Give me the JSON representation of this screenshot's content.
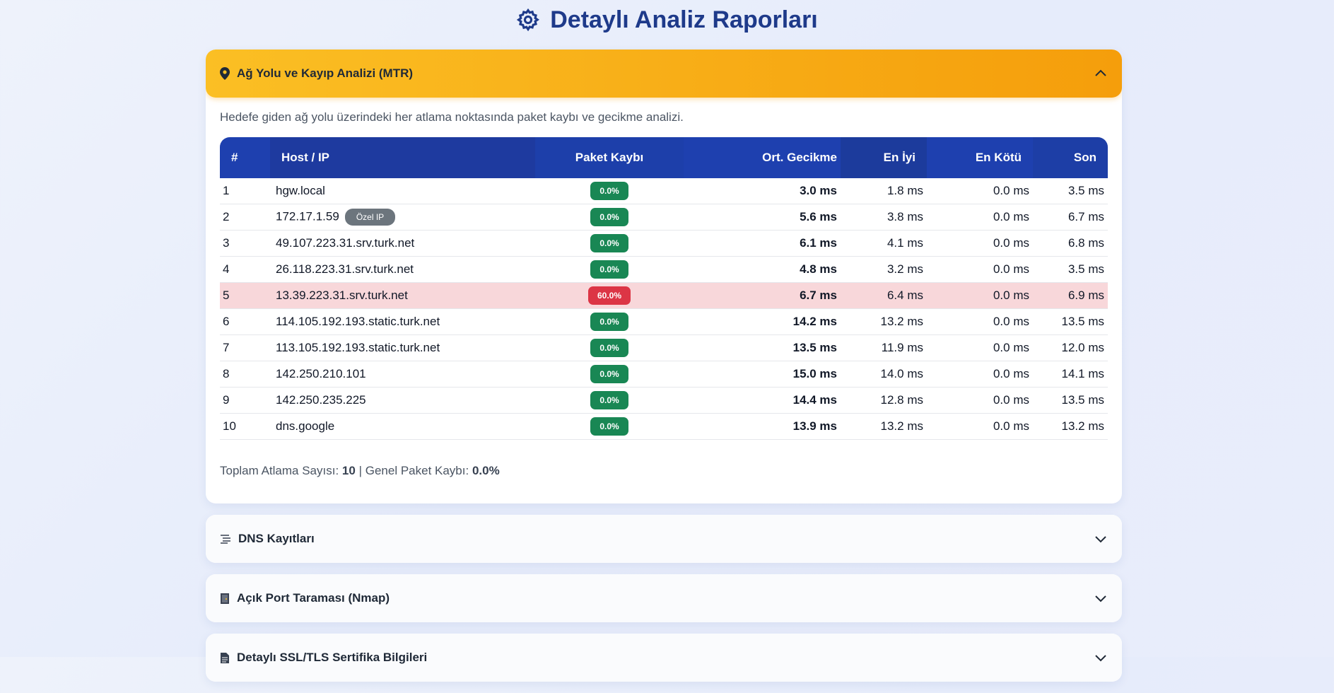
{
  "page": {
    "title": "Detaylı Analiz Raporları",
    "icon": "gear-icon",
    "accent": "#1e3a8a"
  },
  "mtr": {
    "title": "Ağ Yolu ve Kayıp Analizi (MTR)",
    "icon": "map-pin-icon",
    "description": "Hedefe giden ağ yolu üzerindeki her atlama noktasında paket kaybı ve gecikme analizi.",
    "columns": [
      "#",
      "Host / IP",
      "Paket Kaybı",
      "Ort. Gecikme",
      "En İyi",
      "En Kötü",
      "Son"
    ],
    "rows": [
      {
        "num": "1",
        "host": "hgw.local",
        "tag": "",
        "loss": "0.0%",
        "avg": "3.0 ms",
        "best": "1.8 ms",
        "worst": "0.0 ms",
        "last": "3.5 ms",
        "warn": false
      },
      {
        "num": "2",
        "host": "172.17.1.59",
        "tag": "Özel IP",
        "loss": "0.0%",
        "avg": "5.6 ms",
        "best": "3.8 ms",
        "worst": "0.0 ms",
        "last": "6.7 ms",
        "warn": false
      },
      {
        "num": "3",
        "host": "49.107.223.31.srv.turk.net",
        "tag": "",
        "loss": "0.0%",
        "avg": "6.1 ms",
        "best": "4.1 ms",
        "worst": "0.0 ms",
        "last": "6.8 ms",
        "warn": false
      },
      {
        "num": "4",
        "host": "26.118.223.31.srv.turk.net",
        "tag": "",
        "loss": "0.0%",
        "avg": "4.8 ms",
        "best": "3.2 ms",
        "worst": "0.0 ms",
        "last": "3.5 ms",
        "warn": false
      },
      {
        "num": "5",
        "host": "13.39.223.31.srv.turk.net",
        "tag": "",
        "loss": "60.0%",
        "avg": "6.7 ms",
        "best": "6.4 ms",
        "worst": "0.0 ms",
        "last": "6.9 ms",
        "warn": true
      },
      {
        "num": "6",
        "host": "114.105.192.193.static.turk.net",
        "tag": "",
        "loss": "0.0%",
        "avg": "14.2 ms",
        "best": "13.2 ms",
        "worst": "0.0 ms",
        "last": "13.5 ms",
        "warn": false
      },
      {
        "num": "7",
        "host": "113.105.192.193.static.turk.net",
        "tag": "",
        "loss": "0.0%",
        "avg": "13.5 ms",
        "best": "11.9 ms",
        "worst": "0.0 ms",
        "last": "12.0 ms",
        "warn": false
      },
      {
        "num": "8",
        "host": "142.250.210.101",
        "tag": "",
        "loss": "0.0%",
        "avg": "15.0 ms",
        "best": "14.0 ms",
        "worst": "0.0 ms",
        "last": "14.1 ms",
        "warn": false
      },
      {
        "num": "9",
        "host": "142.250.235.225",
        "tag": "",
        "loss": "0.0%",
        "avg": "14.4 ms",
        "best": "12.8 ms",
        "worst": "0.0 ms",
        "last": "13.5 ms",
        "warn": false
      },
      {
        "num": "10",
        "host": "dns.google",
        "tag": "",
        "loss": "0.0%",
        "avg": "13.9 ms",
        "best": "13.2 ms",
        "worst": "0.0 ms",
        "last": "13.2 ms",
        "warn": false
      }
    ],
    "summary": {
      "hops_label": "Toplam Atlama Sayısı:",
      "hops_value": "10",
      "separator": "|",
      "loss_label": "Genel Paket Kaybı:",
      "loss_value": "0.0%"
    }
  },
  "sections": [
    {
      "title": "DNS Kayıtları",
      "icon": "list-icon"
    },
    {
      "title": "Açık Port Taraması (Nmap)",
      "icon": "door-icon"
    },
    {
      "title": "Detaylı SSL/TLS Sertifika Bilgileri",
      "icon": "document-icon"
    }
  ],
  "colors": {
    "header_gold": "#fbbf24",
    "table_header": "#1e40af",
    "ok_badge": "#198754",
    "bad_badge": "#dc3545",
    "warn_row": "#f8d7da"
  }
}
